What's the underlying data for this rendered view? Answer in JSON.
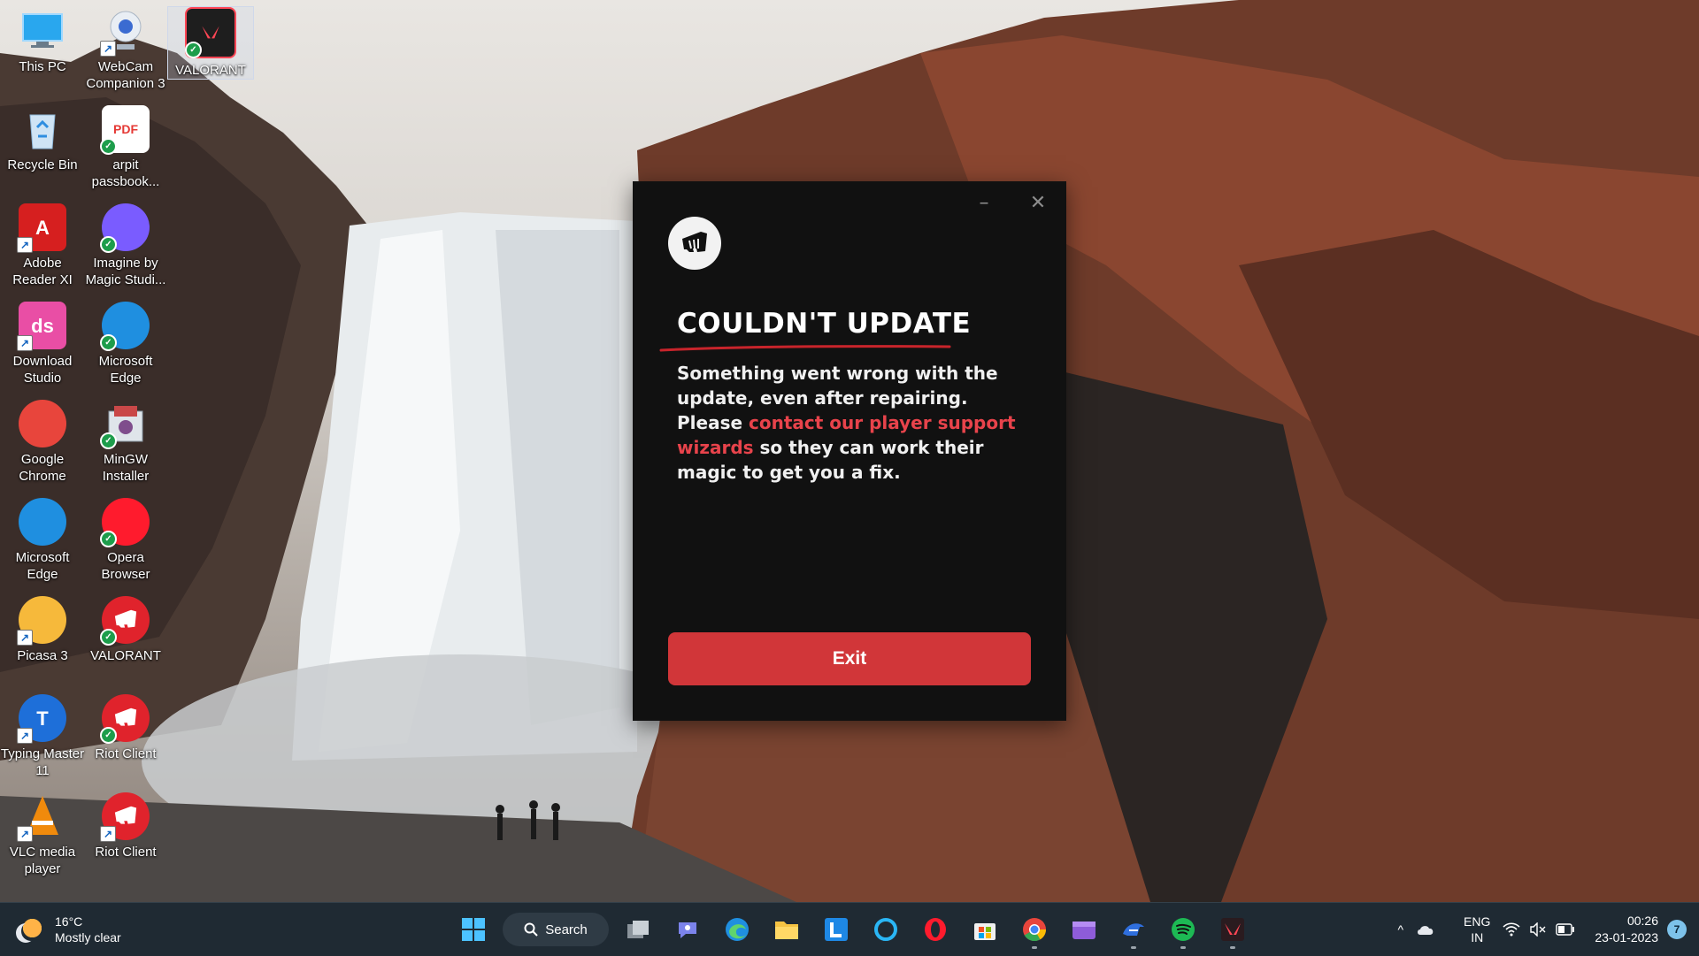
{
  "desktop": {
    "icons": [
      {
        "label": "This PC",
        "icon": "computer-icon",
        "color": "#2aa8f0"
      },
      {
        "label": "WebCam Companion 3",
        "icon": "webcam-icon",
        "color": "#dde3ec"
      },
      {
        "label": "VALORANT",
        "icon": "valorant-icon",
        "color": "#e8404b"
      },
      {
        "label": "Recycle Bin",
        "icon": "recycle-bin-icon",
        "color": "#9fc7e8"
      },
      {
        "label": "arpit passbook...",
        "icon": "pdf-file-icon",
        "color": "#e53935"
      },
      {
        "label": "Adobe Reader XI",
        "icon": "adobe-reader-icon",
        "color": "#d61f1f"
      },
      {
        "label": "Imagine by Magic Studi...",
        "icon": "imagine-icon",
        "color": "#7a5cff"
      },
      {
        "label": "Download Studio",
        "icon": "download-studio-icon",
        "color": "#e94ea5"
      },
      {
        "label": "Microsoft Edge",
        "icon": "edge-icon",
        "color": "#1f8fe0"
      },
      {
        "label": "Google Chrome",
        "icon": "chrome-icon",
        "color": "#e8453c"
      },
      {
        "label": "MinGW Installer",
        "icon": "mingw-icon",
        "color": "#c9d3dc"
      },
      {
        "label": "Microsoft Edge",
        "icon": "edge-icon",
        "color": "#1f8fe0"
      },
      {
        "label": "Opera Browser",
        "icon": "opera-icon",
        "color": "#ff1b2d"
      },
      {
        "label": "Picasa 3",
        "icon": "picasa-icon",
        "color": "#f6b93b"
      },
      {
        "label": "VALORANT",
        "icon": "riot-fist-icon",
        "color": "#e0232c"
      },
      {
        "label": "Typing Master 11",
        "icon": "typing-master-icon",
        "color": "#1e6fd9"
      },
      {
        "label": "Riot Client",
        "icon": "riot-fist-icon",
        "color": "#e0232c"
      },
      {
        "label": "VLC media player",
        "icon": "vlc-icon",
        "color": "#f08a0c"
      },
      {
        "label": "Riot Client",
        "icon": "riot-fist-icon",
        "color": "#e0232c"
      }
    ]
  },
  "dialog": {
    "logo_icon": "riot-fist-icon",
    "minimize_label": "–",
    "close_label": "✕",
    "title": "COULDN'T UPDATE",
    "message_part1": "Something went wrong with the update, even after repairing. Please ",
    "message_link": "contact our player support wizards",
    "message_part2": " so they can work their magic to get you a fix.",
    "exit_label": "Exit",
    "accent_color": "#d13639"
  },
  "taskbar": {
    "weather": {
      "temp": "16°C",
      "condition": "Mostly clear"
    },
    "search_label": "Search",
    "apps": [
      "windows-start-icon",
      "task-view-icon",
      "teams-chat-icon",
      "edge-icon",
      "file-explorer-icon",
      "l-app-icon",
      "cortana-icon",
      "opera-icon",
      "microsoft-store-icon",
      "chrome-icon",
      "clipchamp-icon",
      "teamviewer-icon",
      "spotify-icon",
      "valorant-icon"
    ],
    "tray": {
      "language_line1": "ENG",
      "language_line2": "IN",
      "time": "00:26",
      "date": "23-01-2023",
      "notification_count": "7"
    }
  }
}
